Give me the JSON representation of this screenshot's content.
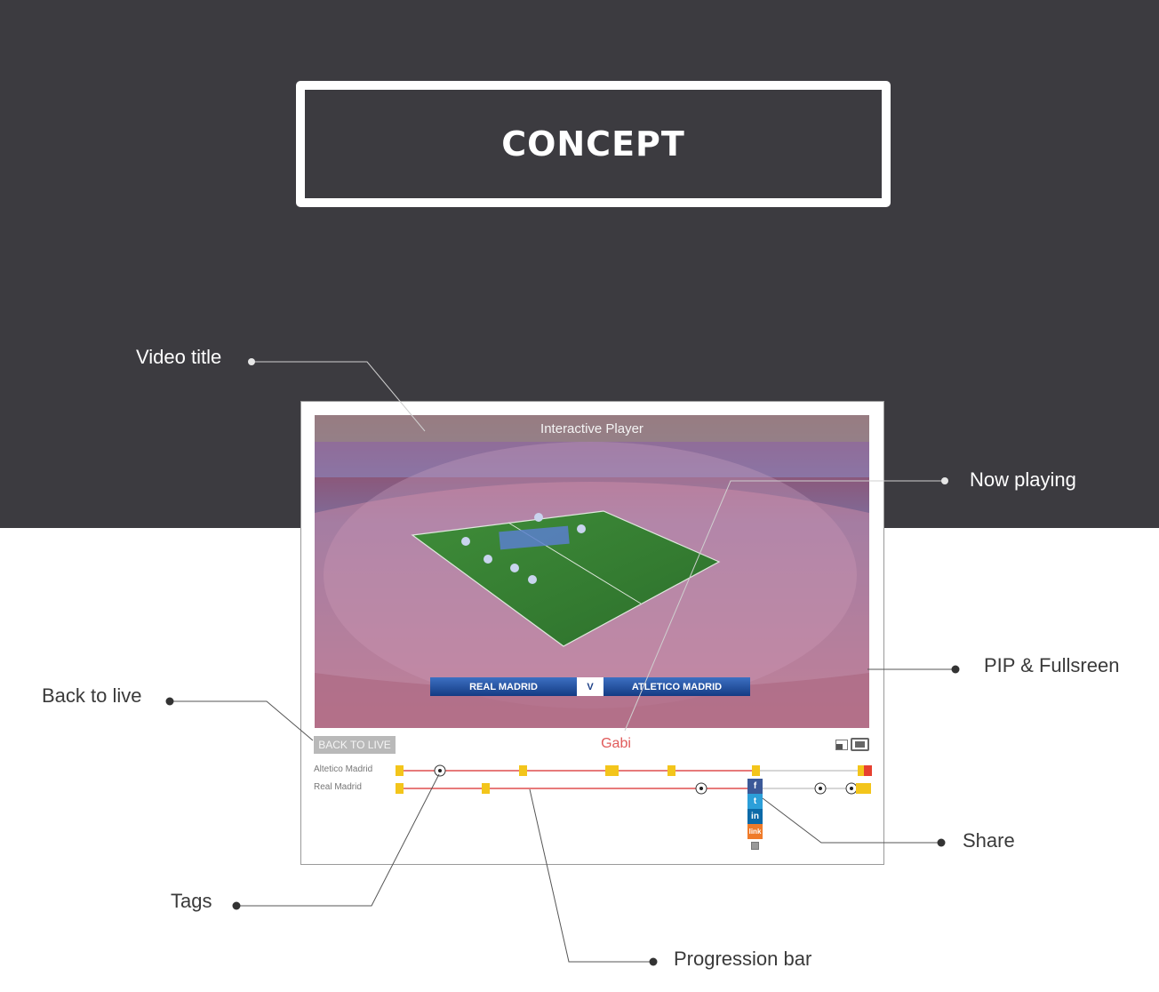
{
  "header": {
    "title": "CONCEPT"
  },
  "annotations": {
    "video_title": "Video title",
    "now_playing": "Now playing",
    "pip_fullscreen": "PIP & Fullsreen",
    "back_to_live": "Back to live",
    "share": "Share",
    "tags": "Tags",
    "progression_bar": "Progression bar"
  },
  "player": {
    "title": "Interactive Player",
    "scoreboard": {
      "home": "REAL MADRID",
      "separator": "V",
      "away": "ATLETICO MADRID"
    },
    "back_to_live_label": "BACK TO LIVE",
    "now_playing": "Gabi",
    "teams": [
      "Altetico Madrid",
      "Real Madrid"
    ],
    "share_buttons": [
      "f",
      "t",
      "in",
      "link"
    ]
  },
  "colors": {
    "background_dark": "#3c3b40",
    "progress": "#e77a7a",
    "now_playing": "#e05a5a",
    "tag_card": "#f3c51b"
  },
  "icons": [
    "soccer-ball-icon",
    "yellow-card-icon",
    "red-card-icon",
    "pip-icon",
    "fullscreen-icon",
    "facebook-icon",
    "twitter-icon",
    "linkedin-icon",
    "link-icon",
    "close-icon"
  ]
}
